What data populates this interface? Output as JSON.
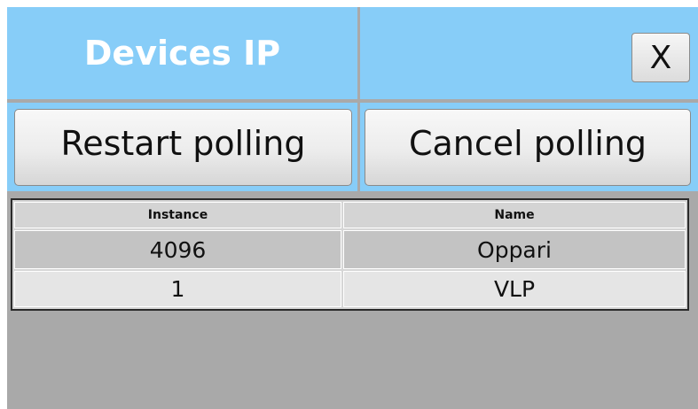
{
  "window": {
    "title": "Devices IP",
    "close_label": "X"
  },
  "actions": {
    "restart_label": "Restart polling",
    "cancel_label": "Cancel polling"
  },
  "table": {
    "columns": [
      "Instance",
      "Name"
    ],
    "rows": [
      {
        "instance": "4096",
        "name": "Oppari"
      },
      {
        "instance": "1",
        "name": "VLP"
      }
    ]
  },
  "colors": {
    "header_bg": "#87cdf8",
    "panel_bg": "#a9a9a9",
    "title_text": "#ffffff"
  }
}
